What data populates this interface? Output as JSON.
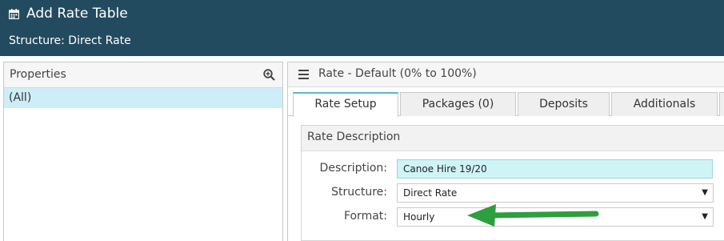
{
  "header": {
    "title": "Add Rate Table",
    "subtitle": "Structure: Direct Rate"
  },
  "properties": {
    "title": "Properties",
    "items": [
      {
        "label": "(All)"
      }
    ]
  },
  "rate": {
    "title": "Rate - Default (0% to 100%)",
    "tabs": [
      {
        "label": "Rate Setup"
      },
      {
        "label": "Packages (0)"
      },
      {
        "label": "Deposits"
      },
      {
        "label": "Additionals"
      }
    ],
    "section_title": "Rate Description",
    "fields": {
      "description": {
        "label": "Description:",
        "value": "Canoe Hire 19/20"
      },
      "structure": {
        "label": "Structure:",
        "value": "Direct Rate"
      },
      "format": {
        "label": "Format:",
        "value": "Hourly"
      }
    }
  },
  "colors": {
    "header_bg": "#234b5f",
    "selected_bg": "#cdeef6",
    "arrow": "#2e9e3e"
  }
}
